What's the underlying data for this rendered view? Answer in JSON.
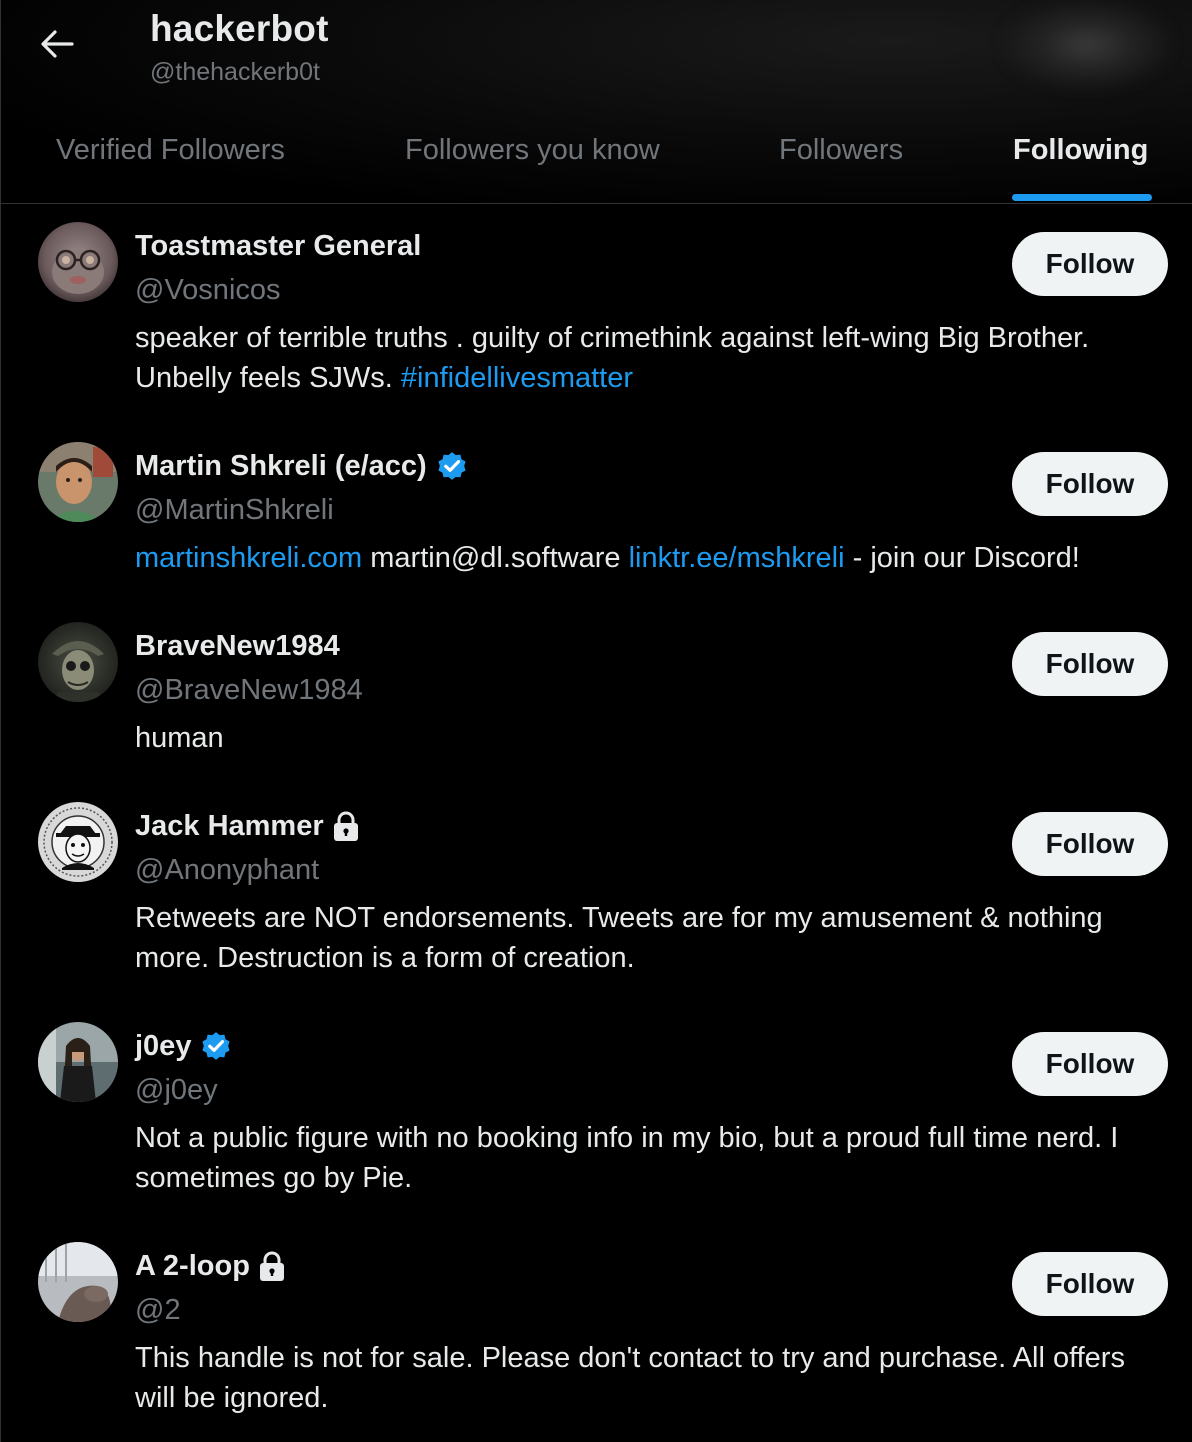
{
  "header": {
    "title": "hackerbot",
    "handle": "@thehackerb0t"
  },
  "tabs": [
    {
      "label": "Verified Followers"
    },
    {
      "label": "Followers you know"
    },
    {
      "label": "Followers"
    },
    {
      "label": "Following"
    }
  ],
  "active_tab": "Following",
  "colors": {
    "accent": "#1d9bf0",
    "background": "#000000",
    "text_primary": "#e7e9ea",
    "text_secondary": "#71767b",
    "button_bg": "#eff3f4"
  },
  "users": [
    {
      "name": "Toastmaster General",
      "handle": "@Vosnicos",
      "verified": false,
      "protected": false,
      "follow_label": "Follow",
      "bio_parts": [
        {
          "text": "speaker of terrible truths . guilty of crimethink against left-wing Big Brother. Unbelly feels SJWs. ",
          "link": false
        },
        {
          "text": "#infidellivesmatter",
          "link": true
        }
      ]
    },
    {
      "name": "Martin Shkreli (e/acc)",
      "handle": "@MartinShkreli",
      "verified": true,
      "protected": false,
      "follow_label": "Follow",
      "bio_parts": [
        {
          "text": "martinshkreli.com",
          "link": true
        },
        {
          "text": " martin@dl.software ",
          "link": false
        },
        {
          "text": "linktr.ee/mshkreli",
          "link": true
        },
        {
          "text": " - join our Discord!",
          "link": false
        }
      ]
    },
    {
      "name": "BraveNew1984",
      "handle": "@BraveNew1984",
      "verified": false,
      "protected": false,
      "follow_label": "Follow",
      "bio_parts": [
        {
          "text": "human",
          "link": false
        }
      ]
    },
    {
      "name": "Jack Hammer",
      "handle": "@Anonyphant",
      "verified": false,
      "protected": true,
      "follow_label": "Follow",
      "bio_parts": [
        {
          "text": "Retweets are NOT endorsements. Tweets are for my amusement & nothing more. Destruction is a form of creation.",
          "link": false
        }
      ]
    },
    {
      "name": "j0ey",
      "handle": "@j0ey",
      "verified": true,
      "protected": false,
      "follow_label": "Follow",
      "bio_parts": [
        {
          "text": "Not a public figure with no booking info in my bio, but a proud full time nerd. I sometimes go by Pie.",
          "link": false
        }
      ]
    },
    {
      "name": "A 2-loop",
      "handle": "@2",
      "verified": false,
      "protected": true,
      "follow_label": "Follow",
      "bio_parts": [
        {
          "text": "This handle is not for sale. Please don't contact to try and purchase. All offers will be ignored.",
          "link": false
        }
      ]
    }
  ]
}
